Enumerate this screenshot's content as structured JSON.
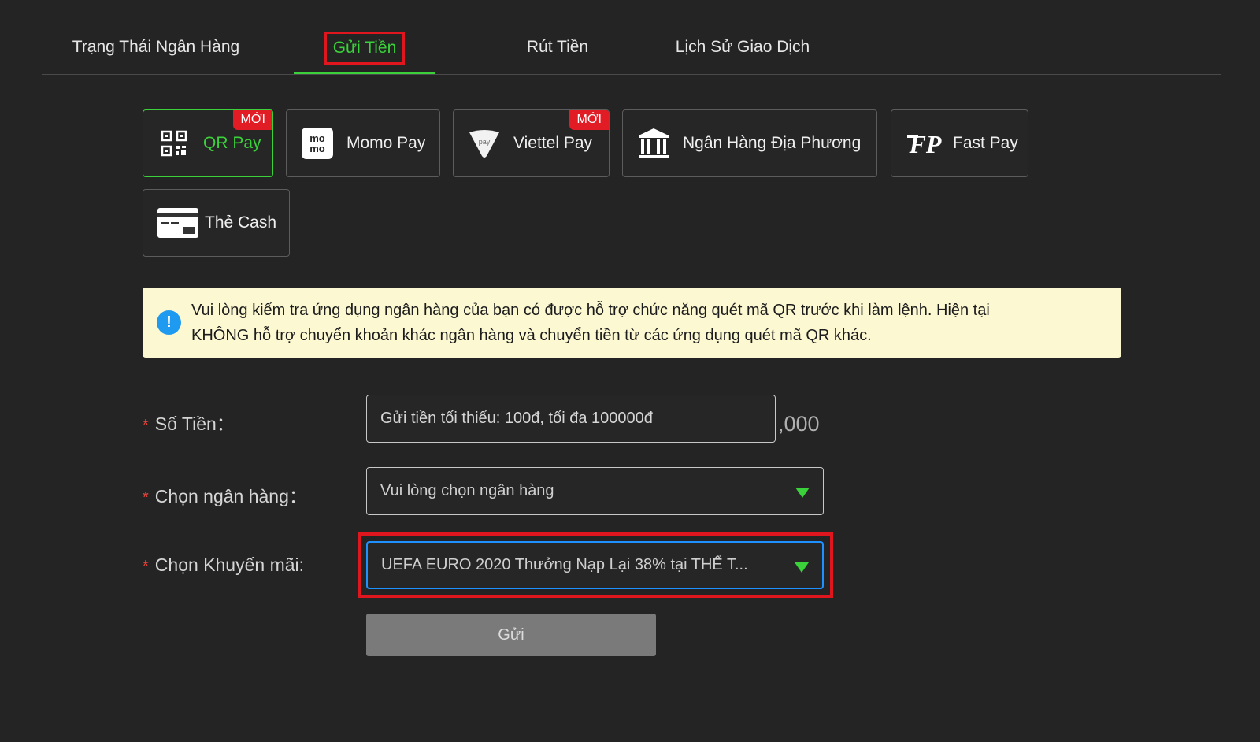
{
  "tabs": [
    {
      "label": "Trạng Thái Ngân Hàng"
    },
    {
      "label": "Gửi Tiền",
      "active": true
    },
    {
      "label": "Rút Tiền"
    },
    {
      "label": "Lịch Sử Giao Dịch"
    }
  ],
  "methods": [
    {
      "label": "QR Pay",
      "icon": "qr-code-icon",
      "badge": "MỚI",
      "active": true
    },
    {
      "label": "Momo Pay",
      "icon": "momo-icon",
      "icon_text": "mo mo"
    },
    {
      "label": "Viettel Pay",
      "icon": "viettel-pay-icon",
      "badge": "MỚI",
      "icon_text": "pay"
    },
    {
      "label": "Ngân Hàng Địa Phương",
      "icon": "bank-building-icon"
    },
    {
      "label": "Fast Pay",
      "icon": "fast-pay-icon",
      "icon_text": "FP"
    },
    {
      "label": "Thẻ Cash",
      "icon": "cash-card-icon"
    }
  ],
  "notice": {
    "line1": "Vui lòng kiểm tra ứng dụng ngân hàng của bạn có được hỗ trợ chức năng quét mã QR trước khi làm lệnh. Hiện tại",
    "line2": "KHÔNG hỗ trợ chuyển khoản khác ngân hàng và chuyển tiền từ các ứng dụng quét mã QR khác.",
    "icon": "!"
  },
  "form": {
    "required_mark": "*",
    "amount_label": "Số Tiền：",
    "amount_placeholder": "Gửi tiền tối thiểu: 100đ, tối đa 100000đ",
    "amount_suffix": ",000",
    "bank_label": "Chọn ngân hàng：",
    "bank_value": "Vui lòng chọn ngân hàng",
    "promo_label": "Chọn Khuyến mãi:",
    "promo_value": "UEFA EURO 2020 Thưởng Nạp Lại 38% tại THỂ T...",
    "submit_label": "Gửi"
  },
  "colors": {
    "accent": "#3ad13a",
    "badge": "#e11c24",
    "highlight_box": "#e0161e",
    "notice_bg": "#fcf8d2",
    "info_icon": "#1e9bf0"
  }
}
